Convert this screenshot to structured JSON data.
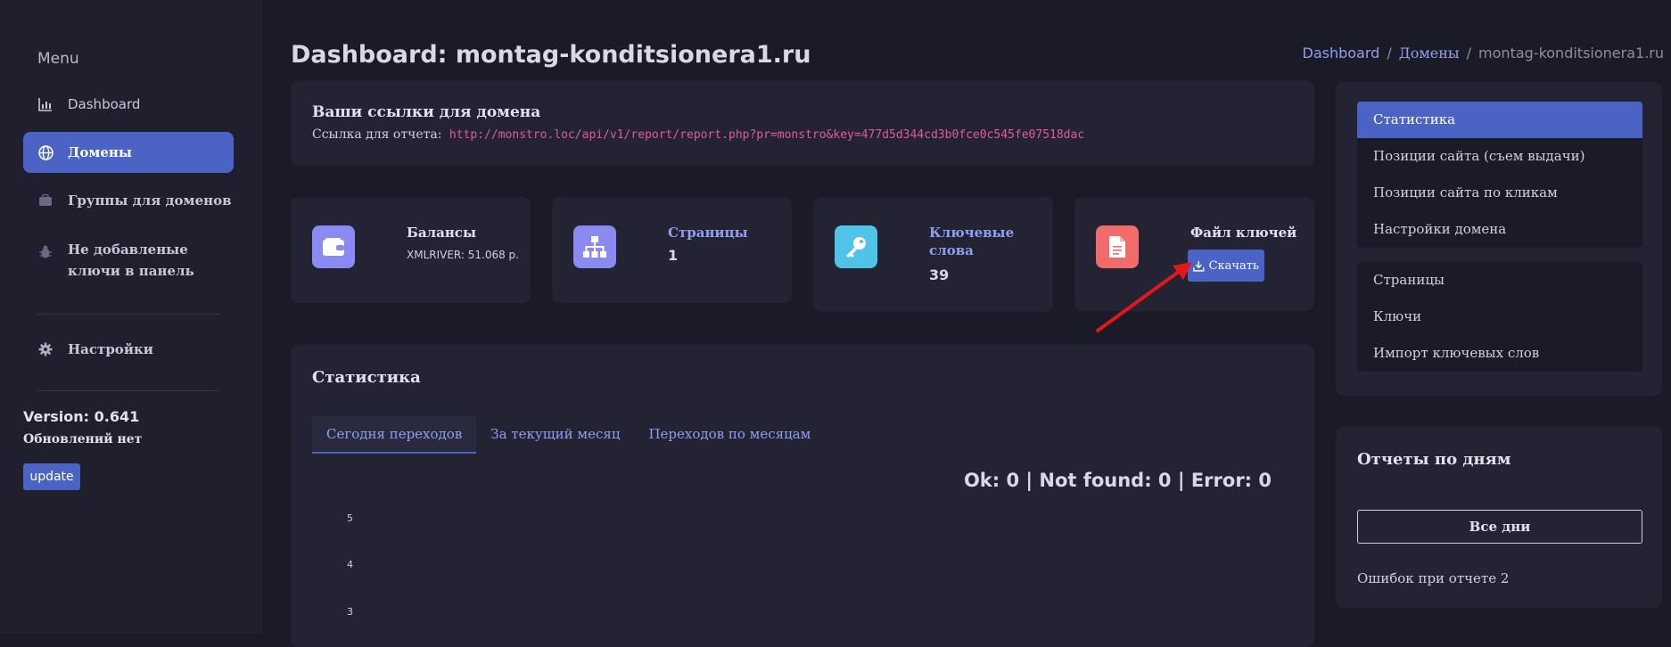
{
  "sidebar": {
    "menu_title": "Menu",
    "items": [
      {
        "label": "Dashboard",
        "icon": "chart-icon"
      },
      {
        "label": "Домены",
        "icon": "globe-icon"
      },
      {
        "label": "Группы для доменов",
        "icon": "briefcase-icon"
      },
      {
        "label": "Не добавленые ключи в панель",
        "icon": "bug-icon"
      },
      {
        "label": "Настройки",
        "icon": "gear-icon"
      }
    ],
    "active_index": 1,
    "version": "Version: 0.641",
    "updates_status": "Обновлений нет",
    "update_button": "update"
  },
  "header": {
    "title": "Dashboard: montag-konditsionera1.ru",
    "breadcrumb": [
      "Dashboard",
      "Домены",
      "montag-konditsionera1.ru"
    ]
  },
  "links_card": {
    "title": "Ваши ссылки для домена",
    "report_label": "Ссылка для отчета:",
    "report_url": "http://monstro.loc/api/v1/report/report.php?pr=monstro&key=477d5d344cd3b0fce0c545fe07518dac"
  },
  "stats": [
    {
      "title": "Балансы",
      "sub": "XMLRIVER: 51.068 р.",
      "icon": "wallet-icon",
      "color": "#8a8af2"
    },
    {
      "title": "Страницы",
      "value": "1",
      "icon": "sitemap-icon",
      "color": "#8a8af2"
    },
    {
      "title_line1": "Ключевые",
      "title_line2": "слова",
      "value": "39",
      "icon": "key-icon",
      "color": "#4fc3e8"
    },
    {
      "title": "Файл ключей",
      "button": "Скачать",
      "icon": "file-icon",
      "color": "#f26b6b"
    }
  ],
  "statistics": {
    "title": "Статистика",
    "tabs": [
      "Сегодня переходов",
      "За текущий месяц",
      "Переходов по месяцам"
    ],
    "active_tab": 0,
    "status_line": "Ok: 0 | Not found: 0 | Error: 0",
    "y_ticks": [
      "5",
      "4",
      "3"
    ]
  },
  "right_menu": {
    "group1": [
      "Статистика",
      "Позиции сайта (съем выдачи)",
      "Позиции сайта по кликам",
      "Настройки домена"
    ],
    "group1_active": 0,
    "group2": [
      "Страницы",
      "Ключи",
      "Импорт ключевых слов"
    ]
  },
  "reports": {
    "title": "Отчеты по дням",
    "all_days_button": "Все дни",
    "errors_text": "Ошибок при отчете 2"
  },
  "colors": {
    "accent": "#4b63c4",
    "annotation_arrow": "#e01818"
  }
}
